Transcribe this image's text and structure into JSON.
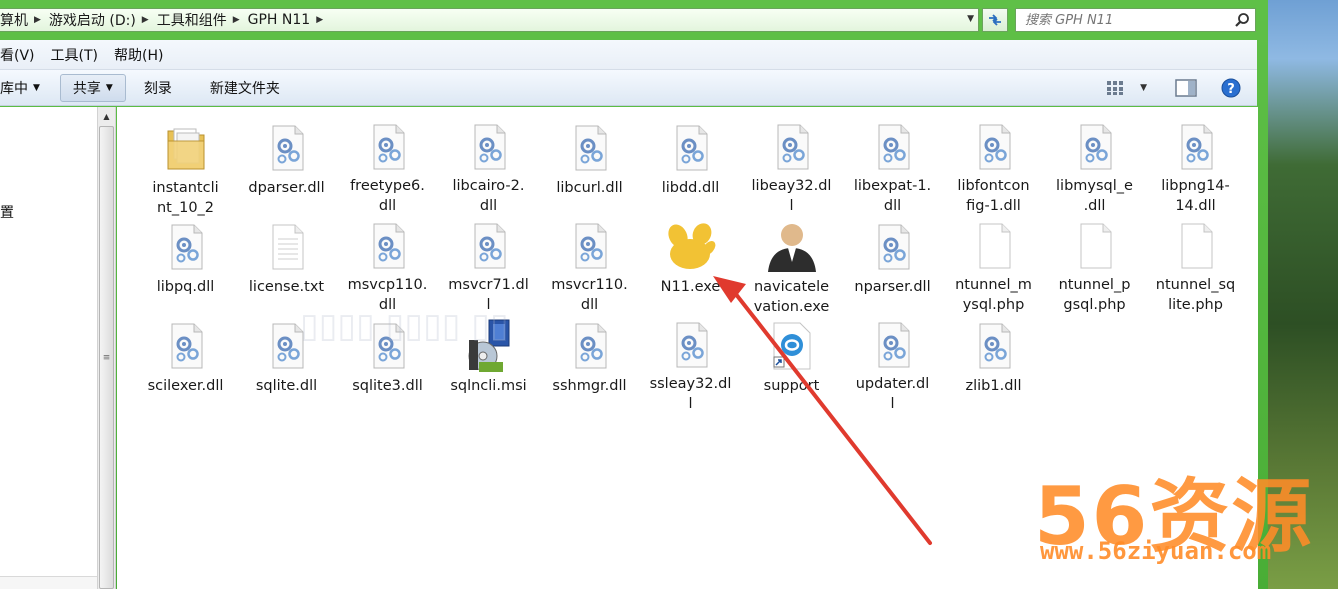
{
  "address_bar": {
    "crumbs": [
      "算机",
      "游戏启动 (D:)",
      "工具和组件",
      "GPH N11"
    ],
    "separator_icon": "chevron-right",
    "dropdown_icon": "chevron-down",
    "refresh_icon": "refresh"
  },
  "search": {
    "placeholder": "搜索 GPH N11",
    "icon": "magnifier"
  },
  "menu": [
    "查看(V)",
    "工具(T)",
    "帮助(H)"
  ],
  "menu_partial_first": "看(V)",
  "toolbar": {
    "library_label": "库中",
    "share_label": "共享",
    "burn_label": "刻录",
    "new_folder_label": "新建文件夹",
    "right_icons": [
      "view-options",
      "preview-pane",
      "help"
    ]
  },
  "nav": {
    "item_label": "置"
  },
  "files": [
    {
      "name": "instantclient_10_2",
      "label_lines": [
        "instantcli",
        "nt_10_2"
      ],
      "icon": "folder"
    },
    {
      "name": "dparser.dll",
      "label_lines": [
        "dparser.dll"
      ],
      "icon": "dll"
    },
    {
      "name": "freetype6.dll",
      "label_lines": [
        "freetype6.",
        "dll"
      ],
      "icon": "dll"
    },
    {
      "name": "libcairo-2.dll",
      "label_lines": [
        "libcairo-2.",
        "dll"
      ],
      "icon": "dll"
    },
    {
      "name": "libcurl.dll",
      "label_lines": [
        "libcurl.dll"
      ],
      "icon": "dll"
    },
    {
      "name": "libdd.dll",
      "label_lines": [
        "libdd.dll"
      ],
      "icon": "dll"
    },
    {
      "name": "libeay32.dll",
      "label_lines": [
        "libeay32.dl",
        "l"
      ],
      "icon": "dll"
    },
    {
      "name": "libexpat-1.dll",
      "label_lines": [
        "libexpat-1.",
        "dll"
      ],
      "icon": "dll"
    },
    {
      "name": "libfontconfig-1.dll",
      "label_lines": [
        "libfontcon",
        "fig-1.dll"
      ],
      "icon": "dll"
    },
    {
      "name": "libmysql_e.dll",
      "label_lines": [
        "libmysql_e",
        ".dll"
      ],
      "icon": "dll"
    },
    {
      "name": "libpng14-14.dll",
      "label_lines": [
        "libpng14-",
        "14.dll"
      ],
      "icon": "dll"
    },
    {
      "name": "libpq.dll",
      "label_lines": [
        "libpq.dll"
      ],
      "icon": "dll"
    },
    {
      "name": "license.txt",
      "label_lines": [
        "license.txt"
      ],
      "icon": "text"
    },
    {
      "name": "msvcp110.dll",
      "label_lines": [
        "msvcp110.",
        "dll"
      ],
      "icon": "dll"
    },
    {
      "name": "msvcr71.dll",
      "label_lines": [
        "msvcr71.dl",
        "l"
      ],
      "icon": "dll"
    },
    {
      "name": "msvcr110.dll",
      "label_lines": [
        "msvcr110.",
        "dll"
      ],
      "icon": "dll"
    },
    {
      "name": "N11.exe",
      "label_lines": [
        "N11.exe"
      ],
      "icon": "navicat-exe"
    },
    {
      "name": "navicatelevation.exe",
      "label_lines": [
        "navicatele",
        "vation.exe"
      ],
      "icon": "user-exe"
    },
    {
      "name": "nparser.dll",
      "label_lines": [
        "nparser.dll"
      ],
      "icon": "dll"
    },
    {
      "name": "ntunnel_mysql.php",
      "label_lines": [
        "ntunnel_m",
        "ysql.php"
      ],
      "icon": "blank"
    },
    {
      "name": "ntunnel_pgsql.php",
      "label_lines": [
        "ntunnel_p",
        "gsql.php"
      ],
      "icon": "blank"
    },
    {
      "name": "ntunnel_sqlite.php",
      "label_lines": [
        "ntunnel_sq",
        "lite.php"
      ],
      "icon": "blank"
    },
    {
      "name": "scilexer.dll",
      "label_lines": [
        "scilexer.dll"
      ],
      "icon": "dll"
    },
    {
      "name": "sqlite.dll",
      "label_lines": [
        "sqlite.dll"
      ],
      "icon": "dll"
    },
    {
      "name": "sqlite3.dll",
      "label_lines": [
        "sqlite3.dll"
      ],
      "icon": "dll"
    },
    {
      "name": "sqlncli.msi",
      "label_lines": [
        "sqlncli.msi"
      ],
      "icon": "installer"
    },
    {
      "name": "sshmgr.dll",
      "label_lines": [
        "sshmgr.dll"
      ],
      "icon": "dll"
    },
    {
      "name": "ssleay32.dll",
      "label_lines": [
        "ssleay32.dl",
        "l"
      ],
      "icon": "dll"
    },
    {
      "name": "support",
      "label_lines": [
        "support"
      ],
      "icon": "shortcut"
    },
    {
      "name": "updater.dll",
      "label_lines": [
        "updater.dl",
        "l"
      ],
      "icon": "dll"
    },
    {
      "name": "zlib1.dll",
      "label_lines": [
        "zlib1.dll"
      ],
      "icon": "dll"
    }
  ],
  "overlay": {
    "watermark_text": "56资源",
    "watermark_url": "www.56ziyuan.com",
    "arrow_color": "#e03a2e",
    "arrow_target": "N11.exe"
  },
  "colors": {
    "window_frame": "#49ad36",
    "watermark": "#ff8c28",
    "arrow": "#e03a2e"
  }
}
